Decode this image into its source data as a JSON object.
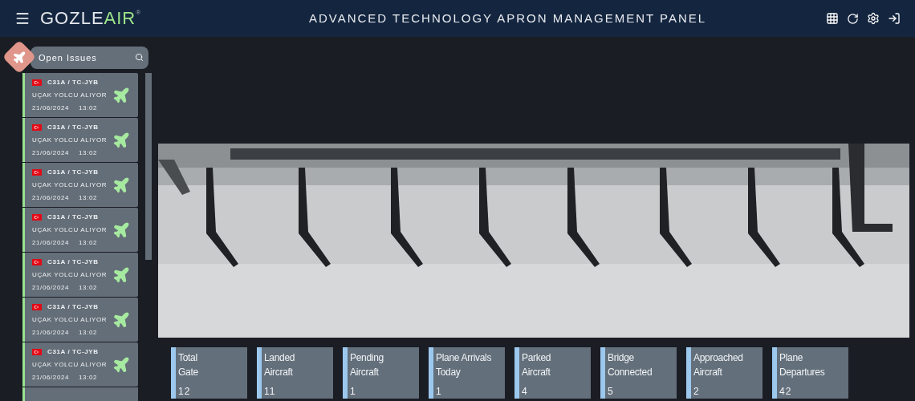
{
  "header": {
    "brand_main": "GOZLE",
    "brand_accent": "AIR",
    "brand_mark": "®",
    "title": "ADVANCED TECHNOLOGY APRON MANAGEMENT PANEL"
  },
  "sidebar": {
    "search": {
      "placeholder": "Open Issues"
    },
    "issues": [
      {
        "code": "C31A / TC-JYB",
        "status": "UÇAK YOLCU ALIYOR",
        "date": "21/06/2024",
        "time": "13:02"
      },
      {
        "code": "C31A / TC-JYB",
        "status": "UÇAK YOLCU ALIYOR",
        "date": "21/06/2024",
        "time": "13:02"
      },
      {
        "code": "C31A / TC-JYB",
        "status": "UÇAK YOLCU ALIYOR",
        "date": "21/06/2024",
        "time": "13:02"
      },
      {
        "code": "C31A / TC-JYB",
        "status": "UÇAK YOLCU ALIYOR",
        "date": "21/06/2024",
        "time": "13:02"
      },
      {
        "code": "C31A / TC-JYB",
        "status": "UÇAK YOLCU ALIYOR",
        "date": "21/06/2024",
        "time": "13:02"
      },
      {
        "code": "C31A / TC-JYB",
        "status": "UÇAK YOLCU ALIYOR",
        "date": "21/06/2024",
        "time": "13:02"
      },
      {
        "code": "C31A / TC-JYB",
        "status": "UÇAK YOLCU ALIYOR",
        "date": "21/06/2024",
        "time": "13:02"
      }
    ]
  },
  "stats": [
    {
      "label": "Total\nGate",
      "value": "12"
    },
    {
      "label": "Landed\nAircraft",
      "value": "11"
    },
    {
      "label": "Pending\nAircraft",
      "value": "1"
    },
    {
      "label": "Plane Arrivals\nToday",
      "value": "1"
    },
    {
      "label": "Parked\nAircraft",
      "value": "4"
    },
    {
      "label": "Bridge\nConnected",
      "value": "5"
    },
    {
      "label": "Approached\nAircraft",
      "value": "2"
    },
    {
      "label": "Plane\nDepartures",
      "value": "42"
    }
  ]
}
